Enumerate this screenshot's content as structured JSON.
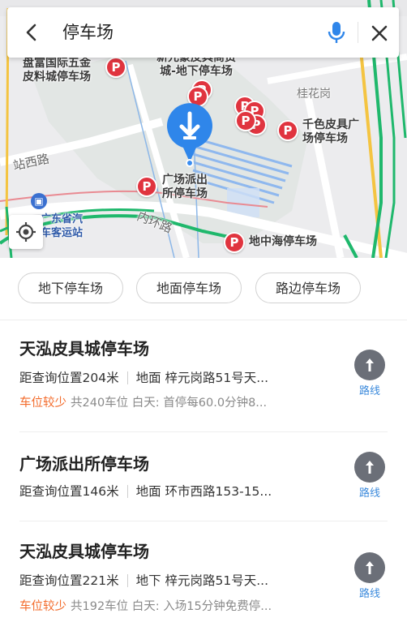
{
  "search": {
    "query": "停车场"
  },
  "map": {
    "labels": {
      "pangfu": "盘富国际五金\n皮料城停车场",
      "xinyuan": "新元豪皮具商贸\n城-地下停车场",
      "guihuagang": "桂花岗",
      "qianse": "千色皮具广\n场停车场",
      "zhanxi": "站西路",
      "guangchang": "广场派出\n所停车场",
      "bus": "广东省汽\n车客运站",
      "neihuan": "内环路",
      "dizhonghai": "地中海停车场"
    },
    "colors": {
      "pin": "#e0343f",
      "center_pin": "#2f86ea",
      "green_road": "#1fb86c",
      "accent_text": "#f36b2b",
      "route_link": "#3d8bdc"
    }
  },
  "filters": [
    "地下停车场",
    "地面停车场",
    "路边停车场"
  ],
  "results": [
    {
      "name": "天泓皮具城停车场",
      "distance": "距查询位置204米",
      "type_address": "地面  梓元岗路51号天...",
      "status": "车位较少",
      "detail": "共240车位  白天: 首停每60.0分钟8...",
      "route_label": "路线"
    },
    {
      "name": "广场派出所停车场",
      "distance": "距查询位置146米",
      "type_address": "地面  环市西路153-15...",
      "route_label": "路线"
    },
    {
      "name": "天泓皮具城停车场",
      "distance": "距查询位置221米",
      "type_address": "地下  梓元岗路51号天...",
      "status": "车位较少",
      "detail": "共192车位  白天: 入场15分钟免费停...",
      "route_label": "路线"
    }
  ]
}
